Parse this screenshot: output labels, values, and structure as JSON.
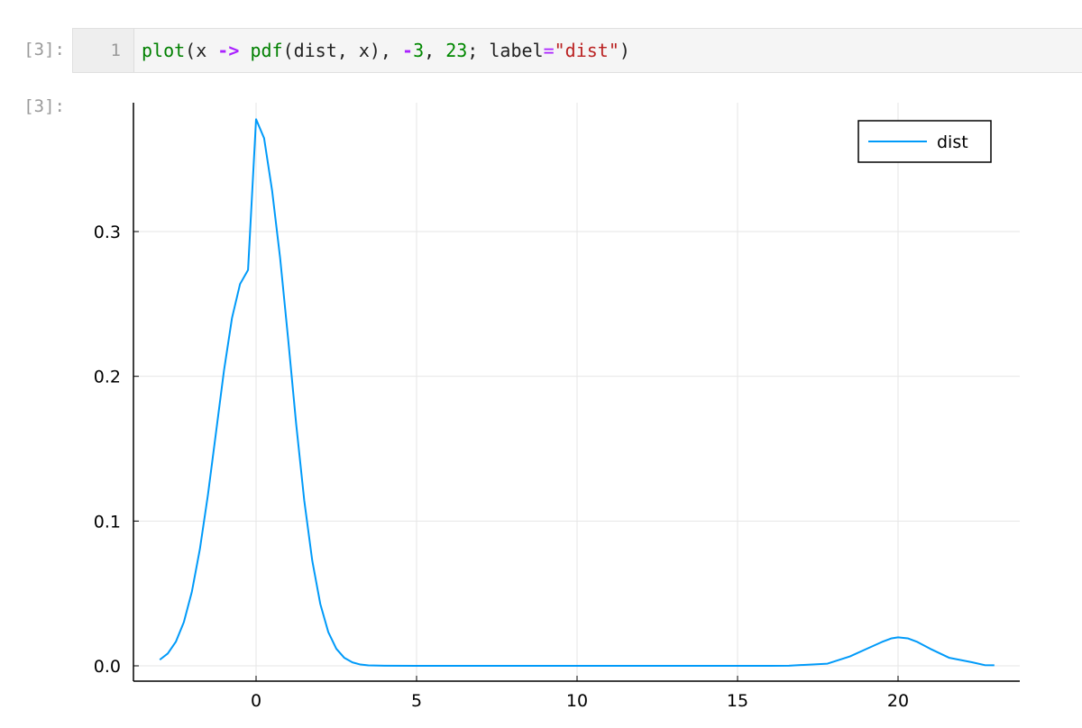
{
  "notebook": {
    "input_prompt": "[3]:",
    "output_prompt": "[3]:",
    "line_number": "1",
    "code_tokens": [
      {
        "text": "plot",
        "type": "builtin"
      },
      {
        "text": "(x ",
        "type": "plain"
      },
      {
        "text": "->",
        "type": "op"
      },
      {
        "text": " ",
        "type": "plain"
      },
      {
        "text": "pdf",
        "type": "builtin"
      },
      {
        "text": "(dist, x), ",
        "type": "plain"
      },
      {
        "text": "-",
        "type": "op"
      },
      {
        "text": "3",
        "type": "num"
      },
      {
        "text": ", ",
        "type": "plain"
      },
      {
        "text": "23",
        "type": "num"
      },
      {
        "text": "; label",
        "type": "plain"
      },
      {
        "text": "=",
        "type": "kw"
      },
      {
        "text": "\"dist\"",
        "type": "str"
      },
      {
        "text": ")",
        "type": "plain"
      }
    ]
  },
  "colors": {
    "series": "#009af9",
    "grid": "#e6e6e6",
    "axis": "#000000"
  },
  "chart_data": {
    "type": "line",
    "title": "",
    "xlabel": "",
    "ylabel": "",
    "xlim": [
      -3,
      23
    ],
    "ylim": [
      0,
      0.38
    ],
    "xticks": [
      0,
      5,
      10,
      15,
      20
    ],
    "xtick_labels": [
      "0",
      "5",
      "10",
      "15",
      "20"
    ],
    "yticks": [
      0.0,
      0.1,
      0.2,
      0.3
    ],
    "ytick_labels": [
      "0.0",
      "0.1",
      "0.2",
      "0.3"
    ],
    "grid": true,
    "legend_position": "top-right",
    "series": [
      {
        "name": "dist",
        "x": [
          -3,
          -2.75,
          -2.5,
          -2.25,
          -2,
          -1.75,
          -1.5,
          -1.25,
          -1,
          -0.75,
          -0.5,
          -0.25,
          0,
          0.25,
          0.5,
          0.75,
          1,
          1.25,
          1.5,
          1.75,
          2,
          2.25,
          2.5,
          2.75,
          3,
          3.25,
          3.5,
          4,
          5,
          6,
          8,
          10,
          12,
          14,
          16,
          16.6,
          17.8,
          18.5,
          19,
          19.5,
          19.8,
          20,
          20.3,
          20.6,
          21,
          21.6,
          22.3,
          22.7,
          23
        ],
        "y": [
          0.0042,
          0.0085,
          0.0166,
          0.0302,
          0.0512,
          0.0807,
          0.1181,
          0.1609,
          0.2039,
          0.2403,
          0.2637,
          0.2735,
          0.3776,
          0.3645,
          0.3282,
          0.2816,
          0.2256,
          0.1669,
          0.1144,
          0.0727,
          0.0428,
          0.0233,
          0.0118,
          0.0055,
          0.0024,
          0.0009,
          0.0003,
          0.0001,
          0,
          0,
          0,
          0,
          0,
          0,
          0,
          0.0001,
          0.0015,
          0.0065,
          0.0115,
          0.0165,
          0.019,
          0.0197,
          0.019,
          0.0165,
          0.0118,
          0.0055,
          0.0025,
          0.0005,
          0.0004
        ]
      }
    ]
  }
}
